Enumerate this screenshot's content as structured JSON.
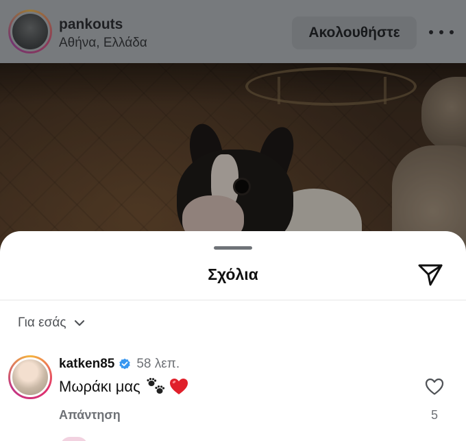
{
  "post": {
    "username": "pankouts",
    "location": "Αθήνα, Ελλάδα",
    "follow_label": "Ακολουθήστε",
    "more_icon": "more-horizontal-icon"
  },
  "comments_sheet": {
    "title": "Σχόλια",
    "share_icon": "send-icon",
    "sort_label": "Για εσάς",
    "sort_icon": "chevron-down-icon"
  },
  "comment": {
    "username": "katken85",
    "verified": true,
    "time": "58 λεπ.",
    "text": "Μωράκι μας",
    "emojis": [
      "paw-prints",
      "red-heart"
    ],
    "reply_label": "Απάντηση",
    "likes": "5",
    "like_icon": "heart-outline-icon"
  },
  "colors": {
    "verified_blue": "#3897f0",
    "heart_red": "#e0202b",
    "text_secondary": "#6e7176"
  }
}
